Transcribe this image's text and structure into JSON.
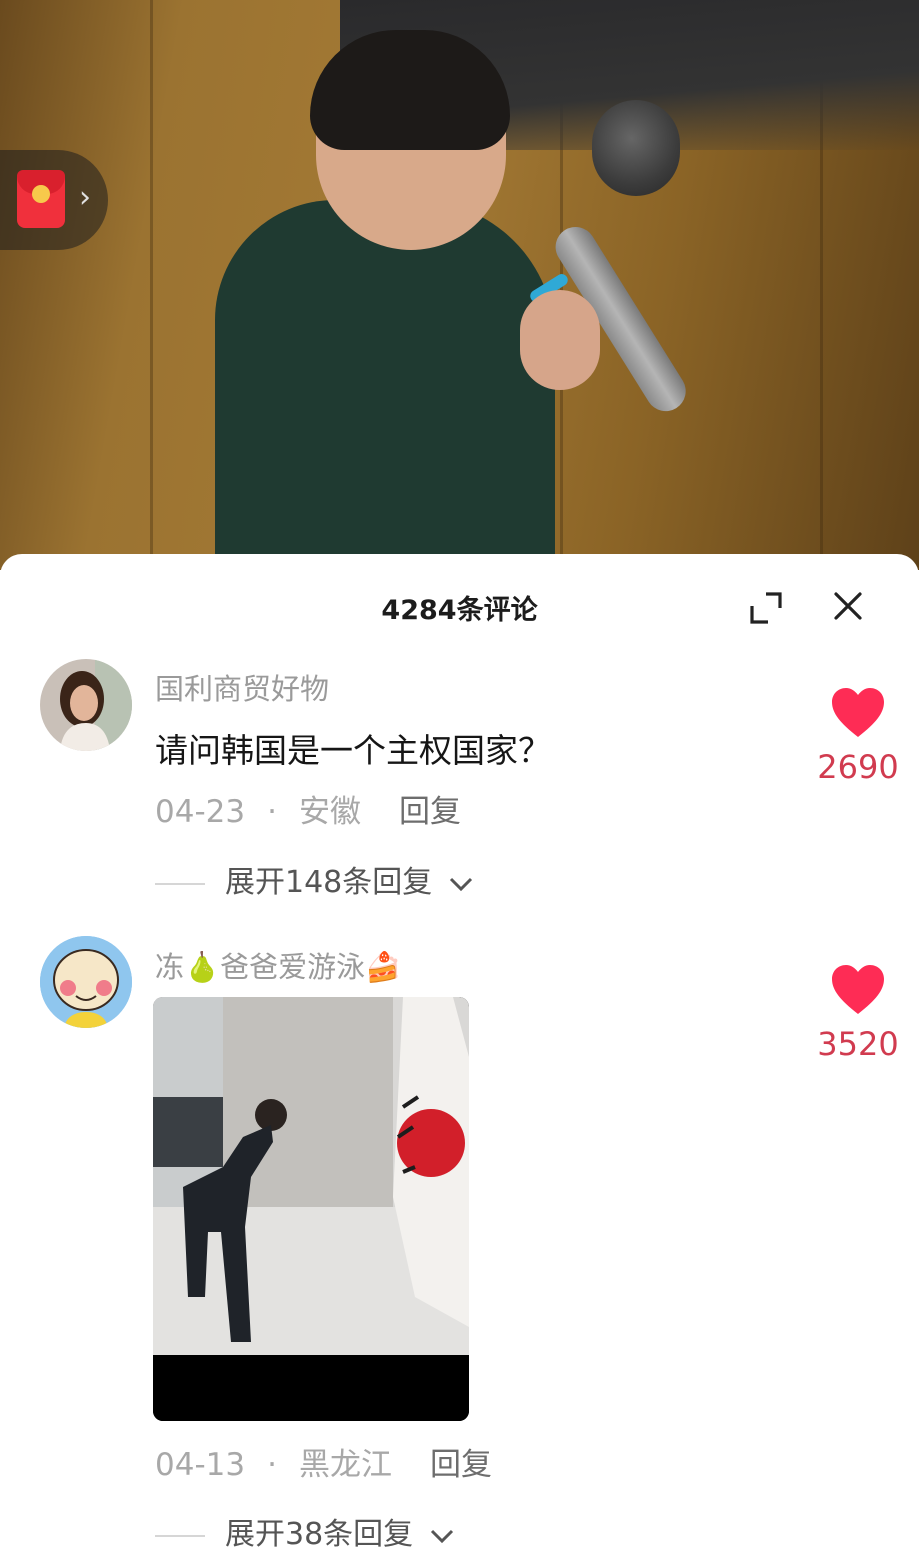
{
  "sheet": {
    "title": "4284条评论"
  },
  "comments": [
    {
      "username": "国利商贸好物",
      "text": "请问韩国是一个主权国家？",
      "date": "04-23",
      "separator": "·",
      "location": "安徽",
      "reply_label": "回复",
      "expand_label": "展开148条回复",
      "likes": "2690"
    },
    {
      "username": "冻🍐爸爸爱游泳🍰",
      "date": "04-13",
      "separator": "·",
      "location": "黑龙江",
      "reply_label": "回复",
      "expand_label": "展开38条回复",
      "likes": "3520"
    }
  ],
  "colors": {
    "like": "#fe2c55",
    "like_count": "#d13b4f"
  },
  "icons": [
    "red-packet-icon",
    "chevron-right-icon",
    "expand-icon",
    "close-icon",
    "heart-icon",
    "chevron-down-icon"
  ]
}
